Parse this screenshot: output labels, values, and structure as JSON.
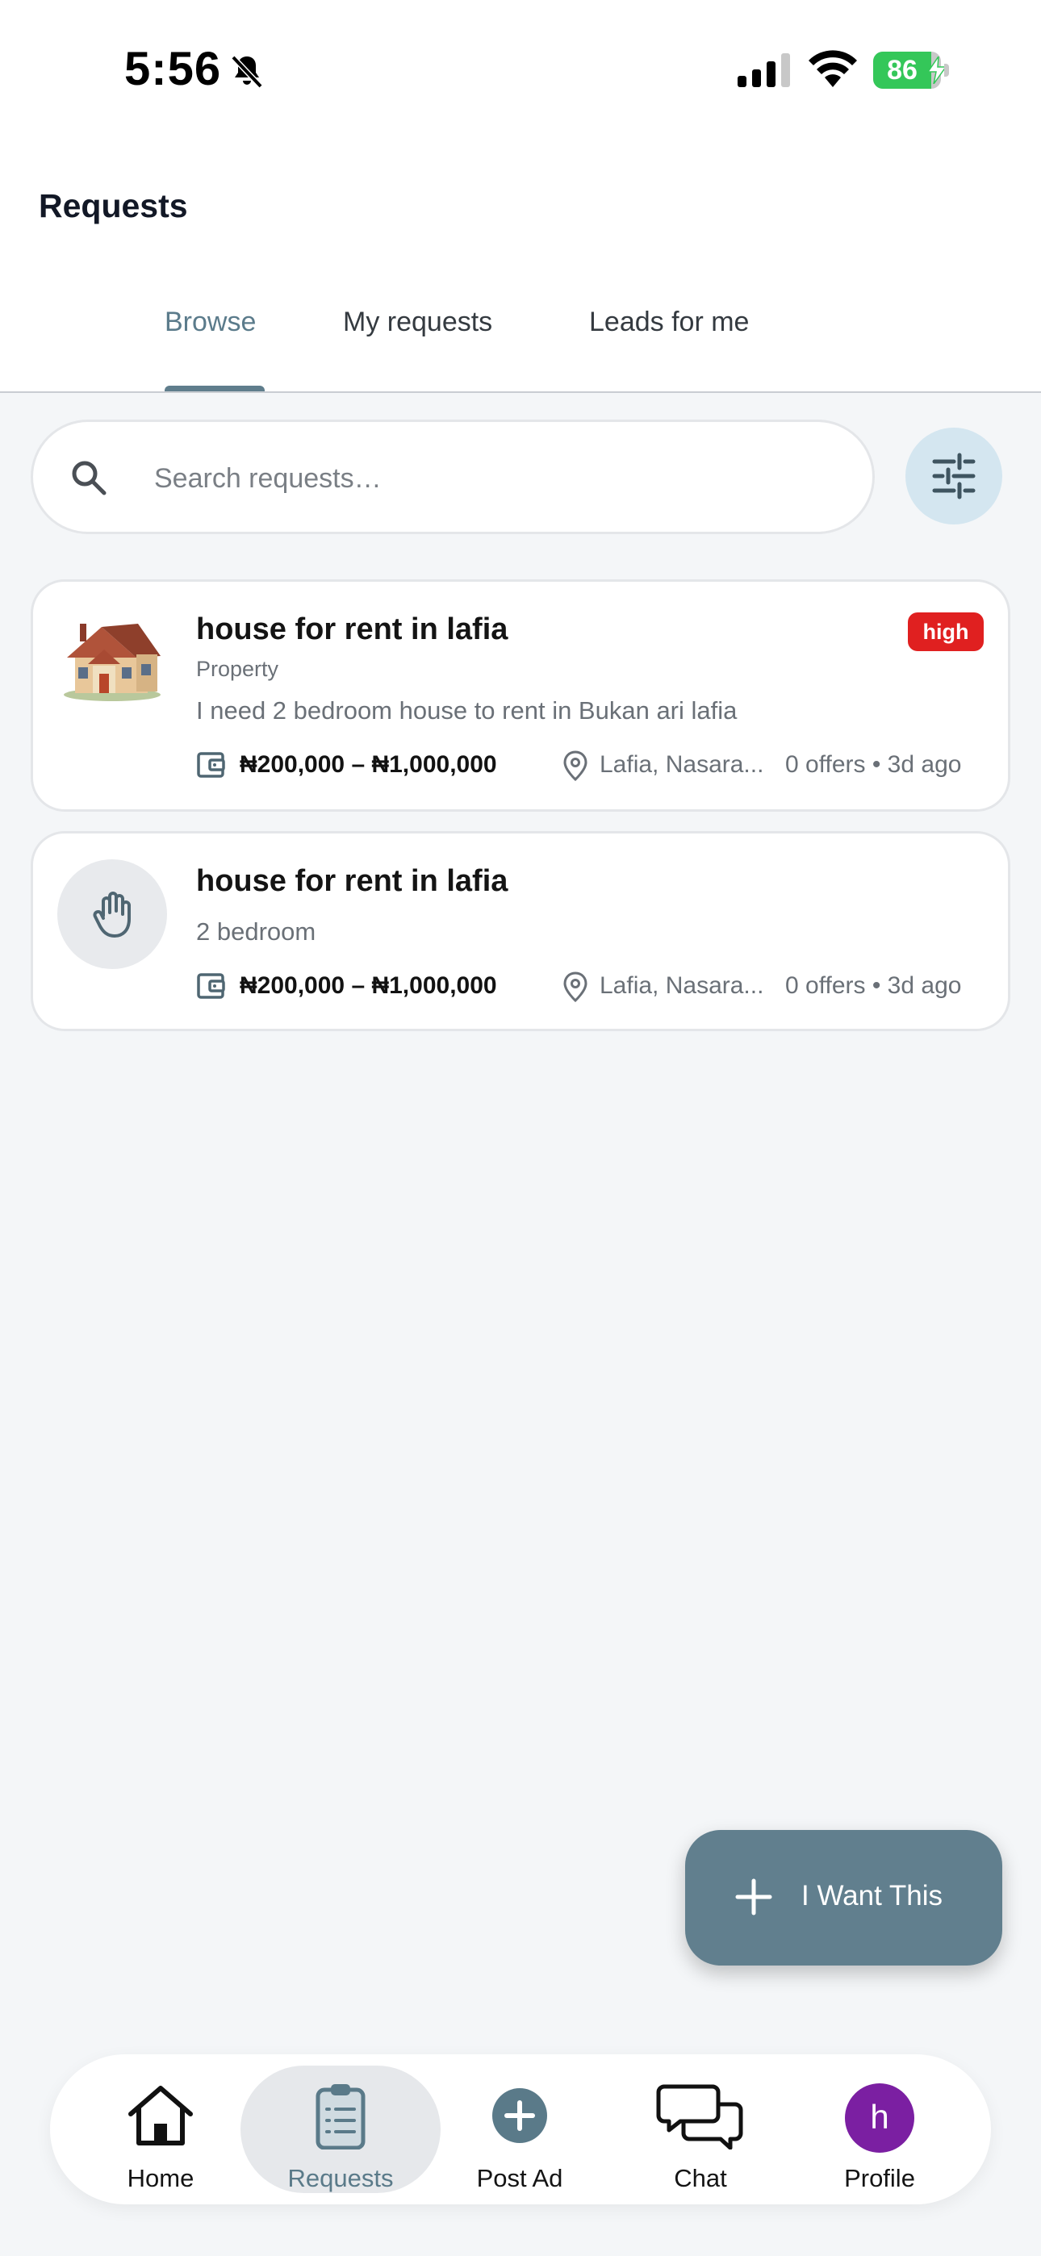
{
  "status_bar": {
    "time": "5:56",
    "battery": "86",
    "battery_level": 0.86
  },
  "header": {
    "title": "Requests",
    "tabs": [
      {
        "label": "Browse",
        "active": true
      },
      {
        "label": "My requests",
        "active": false
      },
      {
        "label": "Leads for me",
        "active": false
      }
    ]
  },
  "search": {
    "placeholder": "Search requests…",
    "value": ""
  },
  "requests": [
    {
      "title": "house for rent in lafia",
      "category": "Property",
      "description": "I need 2 bedroom house to rent in Bukan ari lafia",
      "priority": "high",
      "budget": "₦200,000 – ₦1,000,000",
      "location": "Lafia, Nasara...",
      "offers": "0 offers • 3d ago",
      "thumbnail": "house-image"
    },
    {
      "title": "house for rent in lafia",
      "description": "2 bedroom",
      "budget": "₦200,000 – ₦1,000,000",
      "location": "Lafia, Nasara...",
      "offers": "0 offers • 3d ago",
      "thumbnail": "hand-icon"
    }
  ],
  "fab": {
    "label": "I Want This"
  },
  "bottom_nav": {
    "items": [
      {
        "label": "Home",
        "icon": "home-icon"
      },
      {
        "label": "Requests",
        "icon": "clipboard-icon",
        "active": true
      },
      {
        "label": "Post Ad",
        "icon": "plus-circle-icon"
      },
      {
        "label": "Chat",
        "icon": "chat-bubbles-icon"
      },
      {
        "label": "Profile",
        "avatar_letter": "h"
      }
    ]
  },
  "colors": {
    "accent": "#617f8e",
    "badge_high": "#e02020",
    "avatar": "#7b1fa2",
    "battery": "#34c759",
    "filter_bg": "#d4e6f0"
  }
}
